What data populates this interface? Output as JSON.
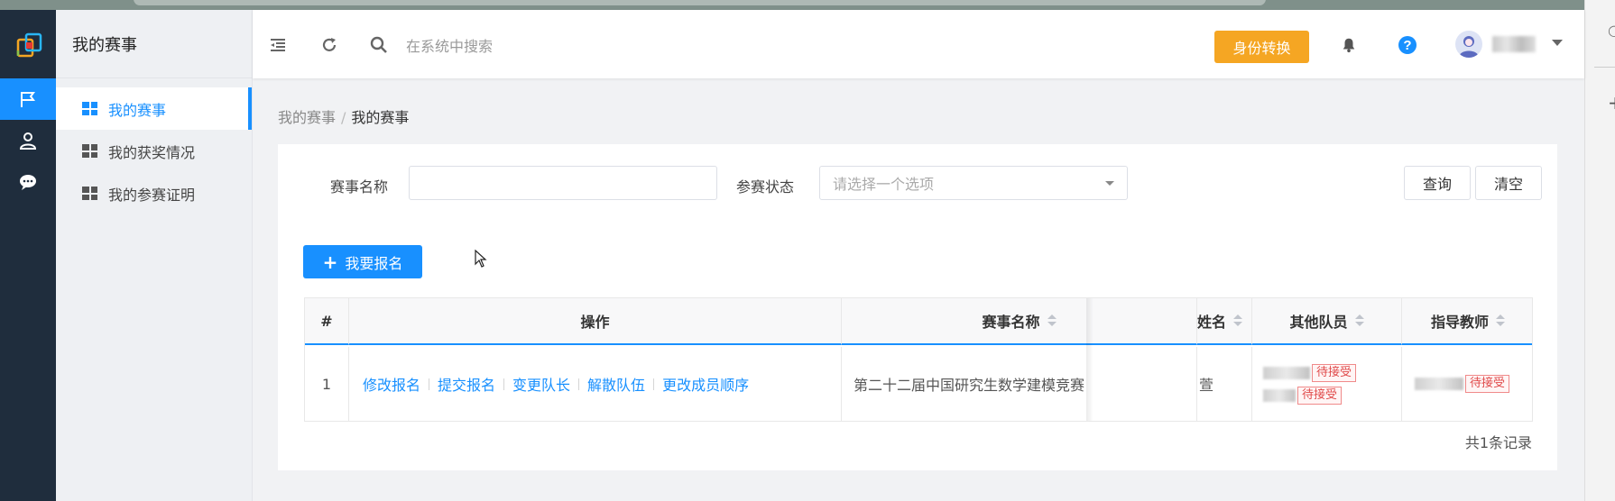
{
  "colors": {
    "accent": "#1890ff",
    "rail_bg": "#1f2d3d",
    "switch_btn": "#f5a623",
    "tag_red": "#e04a4a"
  },
  "sidebar": {
    "title": "我的赛事",
    "rail_icons": [
      "logo-icon",
      "flag-icon",
      "user-icon",
      "chat-icon"
    ],
    "items": [
      {
        "label": "我的赛事",
        "active": true
      },
      {
        "label": "我的获奖情况",
        "active": false
      },
      {
        "label": "我的参赛证明",
        "active": false
      }
    ]
  },
  "header": {
    "search_placeholder": "在系统中搜索",
    "switch_label": "身份转换",
    "icons": [
      "collapse-icon",
      "refresh-icon",
      "search-icon",
      "bell-icon",
      "help-icon",
      "avatar-icon",
      "chevron-down-icon"
    ]
  },
  "breadcrumb": {
    "parent": "我的赛事",
    "current": "我的赛事"
  },
  "filters": {
    "name_label": "赛事名称",
    "name_value": "",
    "status_label": "参赛状态",
    "status_placeholder": "请选择一个选项",
    "query_label": "查询",
    "clear_label": "清空"
  },
  "signup_label": "我要报名",
  "table": {
    "headers": {
      "index": "#",
      "ops": "操作",
      "contest": "赛事名称",
      "captain_partial": "姓名",
      "members": "其他队员",
      "teacher": "指导教师"
    },
    "rows": [
      {
        "index": "1",
        "ops": [
          "修改报名",
          "提交报名",
          "变更队长",
          "解散队伍",
          "更改成员顺序"
        ],
        "contest": "第二十二届中国研究生数学建模竞赛",
        "captain_partial": "萱",
        "members_tag": "待接受",
        "teacher_tag": "待接受"
      }
    ],
    "total": "共1条记录"
  }
}
